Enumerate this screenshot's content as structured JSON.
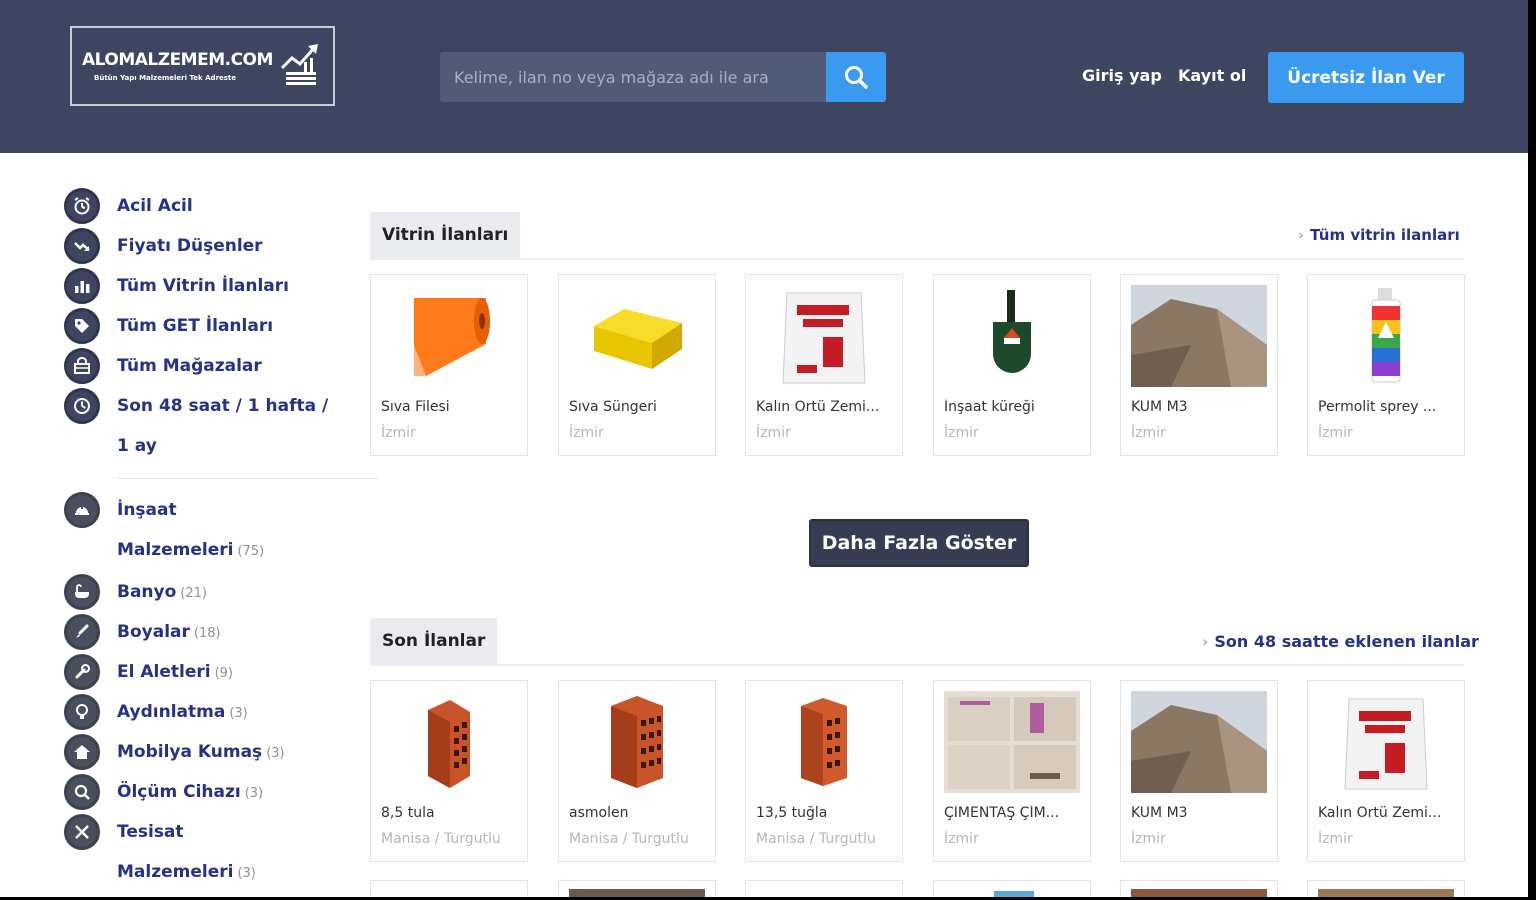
{
  "header": {
    "logo_title": "ALOMALZEMEM.COM",
    "logo_subtitle": "Bütün Yapı Malzemeleri Tek Adreste",
    "search_placeholder": "Kelime, ilan no veya mağaza adı ile ara",
    "login_label": "Giriş yap",
    "register_label": "Kayıt ol",
    "post_ad_label": "Ücretsiz İlan Ver"
  },
  "colors": {
    "header_bg": "#3d4560",
    "accent_blue": "#3a9af0",
    "link_navy": "#263286",
    "button_dark": "#363c52"
  },
  "sidebar": {
    "quick_links": [
      {
        "label": "Acil Acil",
        "icon": "alarm-clock-icon"
      },
      {
        "label": "Fiyatı Düşenler",
        "icon": "trend-down-icon"
      },
      {
        "label": "Tüm Vitrin İlanları",
        "icon": "bar-chart-icon"
      },
      {
        "label": "Tüm GET İlanları",
        "icon": "tag-icon"
      },
      {
        "label": "Tüm Mağazalar",
        "icon": "store-icon"
      },
      {
        "label_line1": "Son 48 saat / 1 hafta /",
        "label_line2": "1 ay",
        "icon": "clock-icon"
      }
    ],
    "categories": [
      {
        "label_line1": "İnşaat",
        "label_line2": "Malzemeleri",
        "count": "(75)",
        "icon": "helmet-icon"
      },
      {
        "label": "Banyo",
        "count": "(21)",
        "icon": "bathtub-icon"
      },
      {
        "label": "Boyalar",
        "count": "(18)",
        "icon": "brush-icon"
      },
      {
        "label": "El Aletleri",
        "count": "(9)",
        "icon": "wrench-icon"
      },
      {
        "label": "Aydınlatma",
        "count": "(3)",
        "icon": "lightbulb-icon"
      },
      {
        "label": "Mobilya Kumaş",
        "count": "(3)",
        "icon": "home-icon"
      },
      {
        "label": "Ölçüm Cihazı",
        "count": "(3)",
        "icon": "magnifier-icon"
      },
      {
        "label_line1": "Tesisat",
        "label_line2": "Malzemeleri",
        "count": "(3)",
        "icon": "tools-icon"
      }
    ]
  },
  "showcase": {
    "tab_label": "Vitrin İlanları",
    "link_label": "Tüm vitrin ilanları",
    "items": [
      {
        "title": "Sıva Filesi",
        "location": "İzmir",
        "image": "mesh-roll"
      },
      {
        "title": "Sıva Süngeri",
        "location": "İzmir",
        "image": "sponge"
      },
      {
        "title": "Kalın Örtü Zemi...",
        "location": "İzmir",
        "image": "sack"
      },
      {
        "title": "İnşaat küreği",
        "location": "İzmir",
        "image": "shovel"
      },
      {
        "title": "KUM M3",
        "location": "İzmir",
        "image": "sand-pile"
      },
      {
        "title": "Permolit sprey ...",
        "location": "İzmir",
        "image": "spray-can"
      }
    ]
  },
  "more_button_label": "Daha Fazla Göster",
  "recent": {
    "tab_label": "Son İlanlar",
    "link_label": "Son 48 saatte eklenen ilanlar",
    "items": [
      {
        "title": "8,5 tula",
        "location": "Manisa / Turgutlu",
        "image": "brick-small"
      },
      {
        "title": "asmolen",
        "location": "Manisa / Turgutlu",
        "image": "brick-large"
      },
      {
        "title": "13,5 tuğla",
        "location": "Manisa / Turgutlu",
        "image": "brick-medium"
      },
      {
        "title": "ÇİMENTAŞ ÇİM...",
        "location": "İzmir",
        "image": "cement-bags"
      },
      {
        "title": "KUM M3",
        "location": "İzmir",
        "image": "sand-pile"
      },
      {
        "title": "Kalın Örtü Zemi...",
        "location": "İzmir",
        "image": "sack"
      }
    ]
  }
}
